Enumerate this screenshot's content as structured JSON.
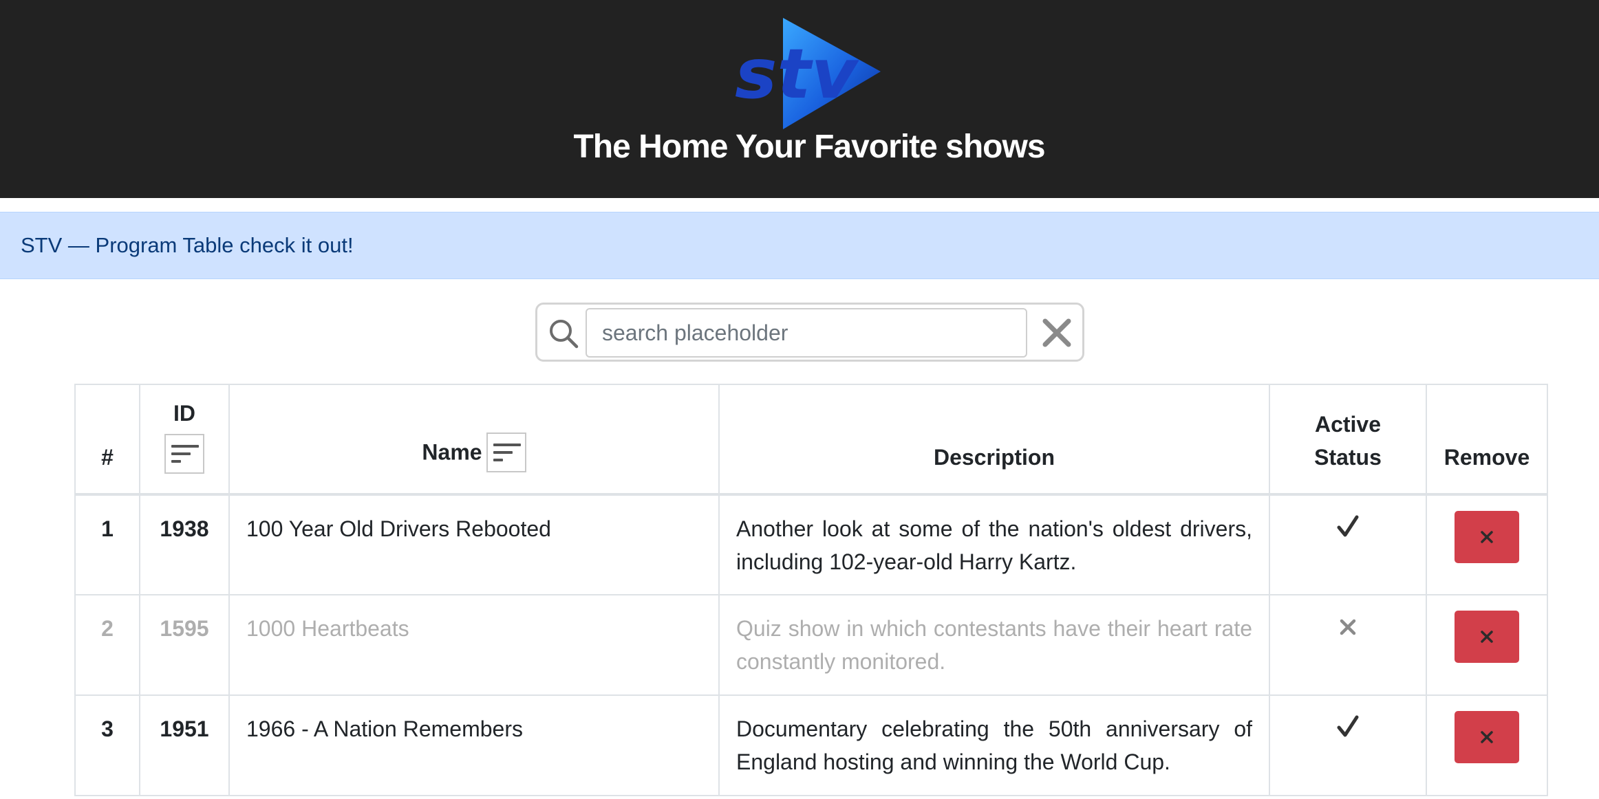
{
  "header": {
    "logo_text": "stv",
    "title": "The Home Your Favorite shows"
  },
  "alert": {
    "text": "STV — Program Table check it out!"
  },
  "search": {
    "placeholder": "search placeholder",
    "value": "",
    "icon": "search-icon",
    "clear_icon": "close-icon"
  },
  "table": {
    "columns": {
      "num": "#",
      "id": "ID",
      "name": "Name",
      "description": "Description",
      "status_line1": "Active",
      "status_line2": "Status",
      "remove": "Remove"
    },
    "rows": [
      {
        "num": "1",
        "id": "1938",
        "name": "100 Year Old Drivers Rebooted",
        "description": "Another look at some of the nation's oldest drivers, including 102-year-old Harry Kartz.",
        "active": true,
        "status_icon": "check-icon"
      },
      {
        "num": "2",
        "id": "1595",
        "name": "1000 Heartbeats",
        "description": "Quiz show in which contestants have their heart rate constantly monitored.",
        "active": false,
        "status_icon": "x-icon"
      },
      {
        "num": "3",
        "id": "1951",
        "name": "1966 - A Nation Remembers",
        "description": "Documentary celebrating the 50th anniversary of England hosting and winning the World Cup.",
        "active": true,
        "status_icon": "check-icon"
      }
    ]
  },
  "colors": {
    "header_bg": "#222222",
    "alert_bg": "#cfe2ff",
    "alert_text": "#0a3a78",
    "remove_button": "#d23f4a",
    "inactive_text": "#aeaeae"
  }
}
